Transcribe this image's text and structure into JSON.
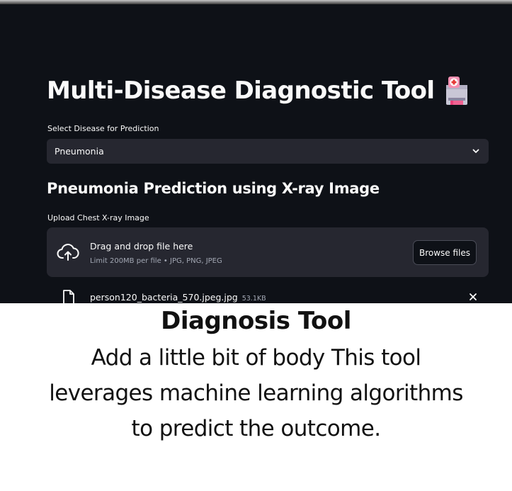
{
  "app": {
    "title": "Multi-Disease Diagnostic Tool",
    "title_icon": "hospital-icon"
  },
  "disease_select": {
    "label": "Select Disease for Prediction",
    "value": "Pneumonia"
  },
  "prediction": {
    "heading": "Pneumonia Prediction using X-ray Image"
  },
  "uploader": {
    "label": "Upload Chest X-ray Image",
    "drop_title": "Drag and drop file here",
    "drop_limit": "Limit 200MB per file • JPG, PNG, JPEG",
    "browse_label": "Browse files",
    "file_name": "person120_bacteria_570.jpeg.jpg",
    "file_size": "53.1KB"
  },
  "caption": {
    "heading": "Diagnosis Tool",
    "body": "Add a little bit of body This tool leverages machine learning algorithms  to predict the outcome."
  },
  "colors": {
    "app_background": "#0e1117",
    "widget_background": "#262730",
    "text": "#fafafa",
    "muted_text": "#a3a8b4",
    "caption_text": "#111111"
  }
}
